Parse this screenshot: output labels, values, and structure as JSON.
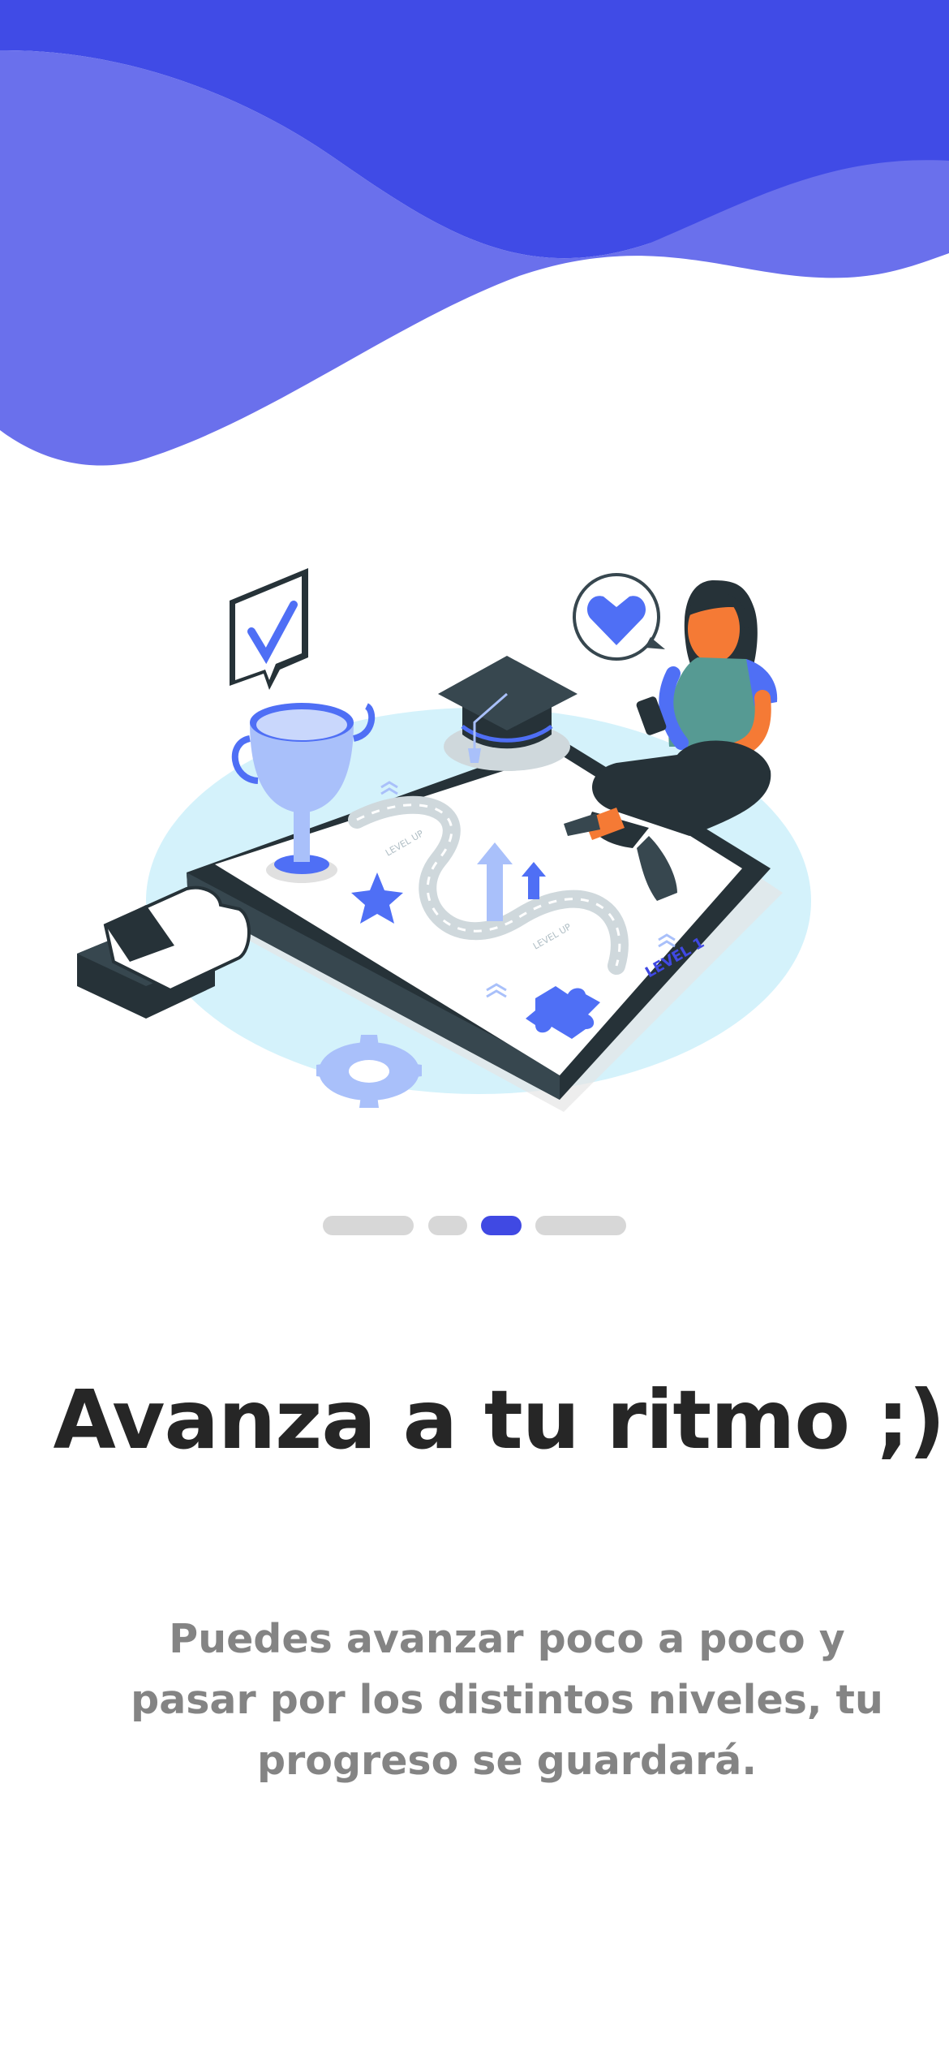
{
  "onboarding": {
    "title": "Avanza a tu ritmo ;)",
    "description": "Puedes avanzar poco a poco y pasar por los distintos niveles, tu progreso se guardará.",
    "pager": {
      "total": 4,
      "active_index": 2
    },
    "illustration": {
      "level_label": "LEVEL 1",
      "path_label_1": "LEVEL UP",
      "path_label_2": "LEVEL UP"
    }
  },
  "colors": {
    "wave_dark": "#404BE6",
    "wave_light": "#6A70EC",
    "accent": "#4049E3",
    "title": "#262626",
    "description": "#848484",
    "pager_inactive": "#D7D7D7"
  }
}
